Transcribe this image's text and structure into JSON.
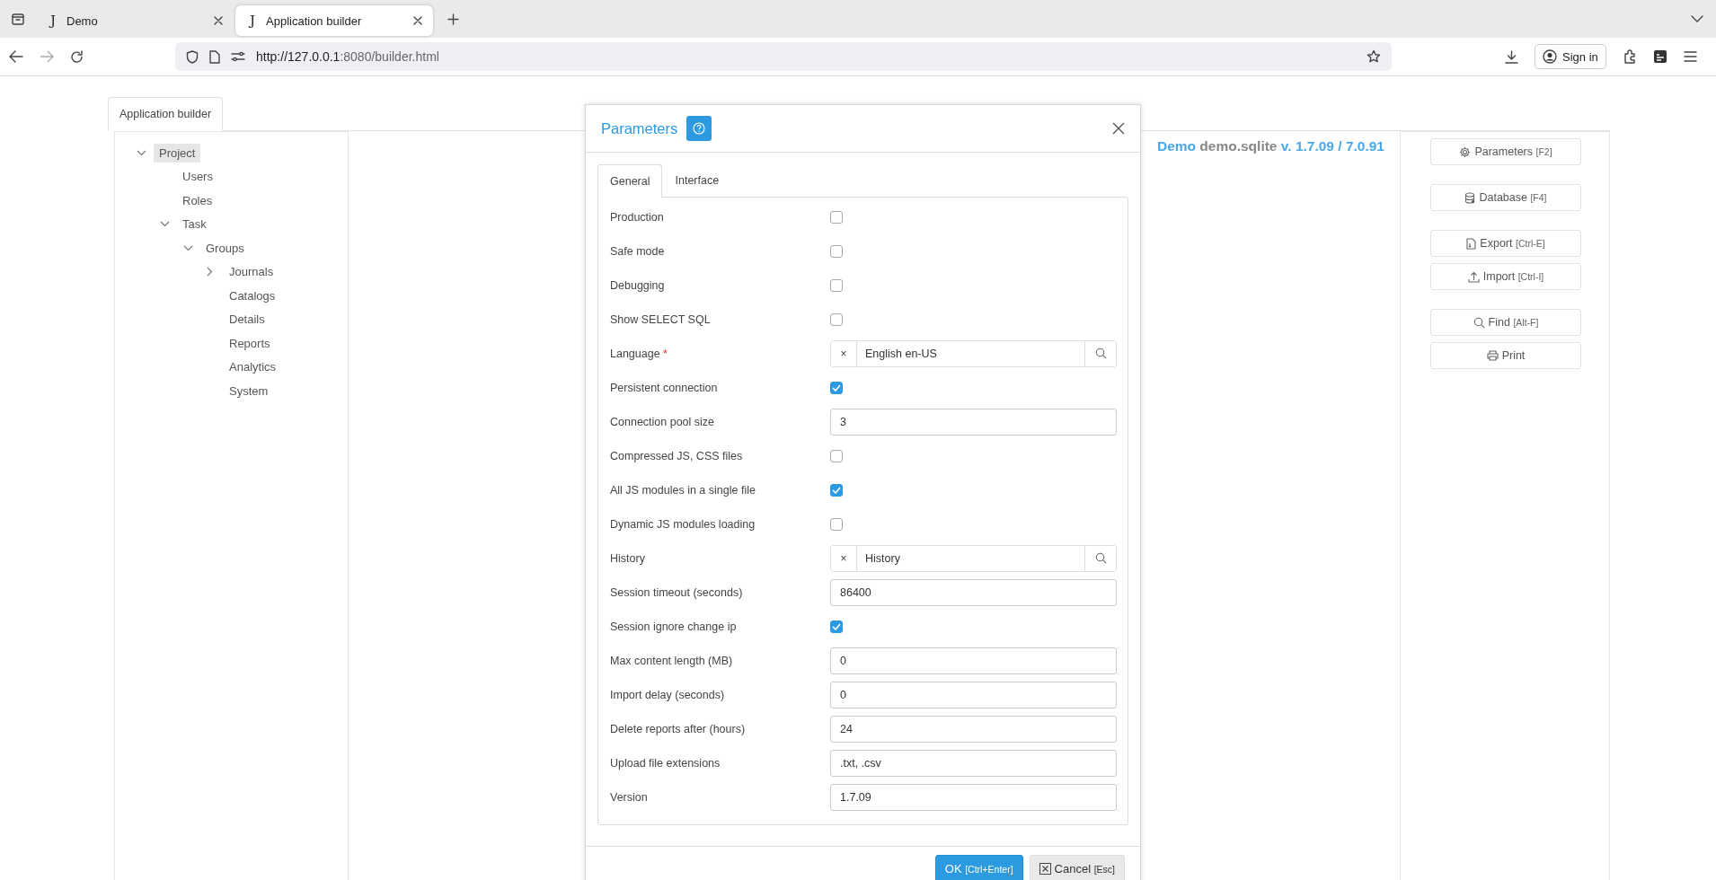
{
  "browser": {
    "tabs": [
      {
        "icon": "J",
        "title": "Demo",
        "selected": false
      },
      {
        "icon": "J",
        "title": "Application builder",
        "selected": true
      }
    ],
    "url": {
      "host": "http://127.0.0.1",
      "path": ":8080/builder.html"
    },
    "sign_in": "Sign in"
  },
  "page_tab": {
    "label": "Application builder",
    "selected": true
  },
  "tree": [
    {
      "label": "Project",
      "expanded": true,
      "selected": true,
      "children": [
        {
          "label": "Users",
          "selected": false
        },
        {
          "label": "Roles",
          "selected": false
        },
        {
          "label": "Task",
          "expanded": true,
          "selected": false,
          "children": [
            {
              "label": "Groups",
              "expanded": true,
              "selected": false,
              "children": [
                {
                  "label": "Journals",
                  "expanded": false,
                  "selected": false
                },
                {
                  "label": "Catalogs",
                  "selected": false
                },
                {
                  "label": "Details",
                  "selected": false
                },
                {
                  "label": "Reports",
                  "selected": false
                },
                {
                  "label": "Analytics",
                  "selected": false
                },
                {
                  "label": "System",
                  "selected": false
                }
              ]
            }
          ]
        }
      ]
    }
  ],
  "heading": {
    "app": "Demo",
    "database": "demo.sqlite",
    "version": "v. 1.7.09 / 7.0.91"
  },
  "action_groups": [
    [
      {
        "kind": "parameters",
        "label": "Parameters",
        "shortcut": "[F2]"
      }
    ],
    [
      {
        "kind": "database",
        "label": "Database",
        "shortcut": "[F4]"
      }
    ],
    [
      {
        "kind": "export",
        "label": "Export",
        "shortcut": "[Ctrl-E]"
      },
      {
        "kind": "import",
        "label": "Import",
        "shortcut": "[Ctrl-I]"
      }
    ],
    [
      {
        "kind": "find",
        "label": "Find",
        "shortcut": "[Alt-F]"
      },
      {
        "kind": "print",
        "label": "Print"
      }
    ]
  ],
  "dialog": {
    "title": "Parameters",
    "tabs": [
      {
        "label": "General",
        "selected": true
      },
      {
        "label": "Interface",
        "selected": false
      }
    ],
    "fields": [
      {
        "kind": "checkbox",
        "label": "Production",
        "checked": false
      },
      {
        "kind": "checkbox",
        "label": "Safe mode",
        "checked": false
      },
      {
        "kind": "checkbox",
        "label": "Debugging",
        "checked": false
      },
      {
        "kind": "checkbox",
        "label": "Show SELECT SQL",
        "checked": false
      },
      {
        "kind": "lookup",
        "label": "Language",
        "required_mark": "*",
        "clear": "×",
        "value": "English en-US"
      },
      {
        "kind": "checkbox",
        "label": "Persistent connection",
        "checked": true
      },
      {
        "kind": "text",
        "label": "Connection pool size",
        "value": "3"
      },
      {
        "kind": "checkbox",
        "label": "Compressed JS, CSS files",
        "checked": false
      },
      {
        "kind": "checkbox",
        "label": "All JS modules in a single file",
        "checked": true
      },
      {
        "kind": "checkbox",
        "label": "Dynamic JS modules loading",
        "checked": false
      },
      {
        "kind": "lookup",
        "label": "History",
        "clear": "×",
        "value": "History"
      },
      {
        "kind": "text",
        "label": "Session timeout (seconds)",
        "value": "86400"
      },
      {
        "kind": "checkbox",
        "label": "Session ignore change ip",
        "checked": true
      },
      {
        "kind": "text",
        "label": "Max content length (MB)",
        "value": "0"
      },
      {
        "kind": "text",
        "label": "Import delay (seconds)",
        "value": "0"
      },
      {
        "kind": "text",
        "label": "Delete reports after (hours)",
        "value": "24"
      },
      {
        "kind": "text",
        "label": "Upload file extensions",
        "value": ".txt, .csv"
      },
      {
        "kind": "text",
        "label": "Version",
        "value": "1.7.09"
      }
    ],
    "buttons": [
      {
        "kind": "primary",
        "label": "OK",
        "shortcut": "[Ctrl+Enter]"
      },
      {
        "kind": "cancel",
        "label": "Cancel",
        "shortcut": "[Esc]"
      }
    ]
  }
}
